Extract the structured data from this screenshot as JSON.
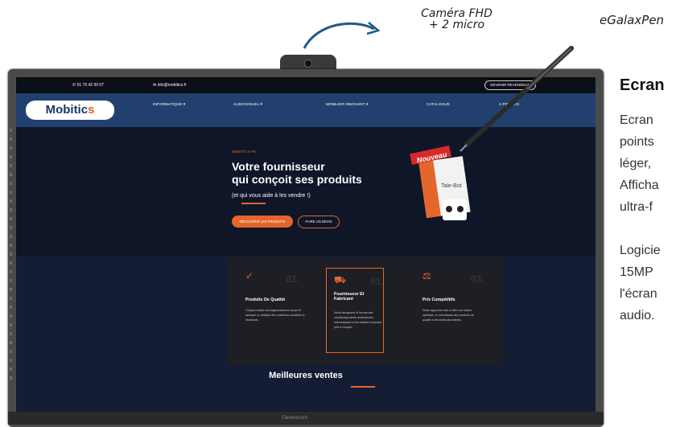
{
  "callouts": {
    "camera": "Caméra FHD\n+ 2 micro",
    "pen": "eGalaxPen"
  },
  "screen": {
    "topbar": {
      "phone": "01 76 42 00 07",
      "email": "info@mobitics.fr",
      "cta": "DEVENIR REVENDEUR"
    },
    "logo": {
      "main": "Mobitic",
      "accent": "s"
    },
    "nav": [
      "INFORMATIQUE ▾",
      "AUDIOVISUEL ▾",
      "MOBILIER INNOVANT ▾",
      "CATALOGUE",
      "À PROPOS"
    ],
    "hero": {
      "eyebrow": "MOBITIC'S.FR",
      "title_line1": "Votre fournisseur",
      "title_line2": "qui conçoit ses produits",
      "subtitle": "(et qui vous aide à les vendre !)",
      "button_primary": "DÉCOUVRIR LES PRODUITS",
      "button_secondary": "FAIRE UN DEVIS",
      "badge": "Nouveau",
      "product": "Tale-Bot"
    },
    "features": [
      {
        "num": "02.",
        "title": "Produits De Qualité",
        "desc": "Chaque article est soigneusement conçu et fabriqué en utilisant des matériaux durables et résistants."
      },
      {
        "num": "01.",
        "title": "Fournisseur Et Fabricant",
        "desc": "Nous fabriquons et livrons des solutions/produits audiovisuels, informatiques et du mobilier innovant prêt à l'emploi."
      },
      {
        "num": "03.",
        "title": "Prix Compétitifs",
        "desc": "Notre approche vise à offrir une valeur optimale, en fournissant des produits de qualité à des tarifs abordables."
      }
    ],
    "best_sellers": "Meilleures ventes",
    "brand": "Clevertouch"
  },
  "content": {
    "heading": "Ecran",
    "lines": [
      "Ecran",
      "points",
      "léger,",
      "Afficha",
      "ultra-f",
      "",
      "Logicie",
      "15MP",
      "l'écran",
      "audio."
    ]
  },
  "colors": {
    "accent": "#e4662a",
    "nav": "#22406f",
    "screen_bg": "#141d33"
  }
}
